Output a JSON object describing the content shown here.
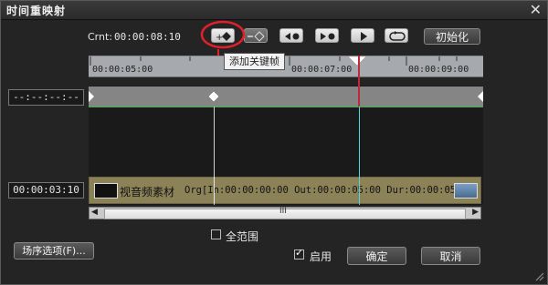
{
  "window": {
    "title": "时间重映射"
  },
  "toolbar": {
    "crnt_label": "Crnt:",
    "crnt_value": "00:00:08:10",
    "init_label": "初始化",
    "tooltip": "添加关键帧"
  },
  "ruler": {
    "ticks": [
      "00:00:05:00",
      "00:00:07:00",
      "00:00:09:00"
    ]
  },
  "fields": {
    "keyframe_time": "--:--:--:--",
    "clip_time": "00:00:03:10"
  },
  "clip": {
    "name": "视音频素材",
    "info": "Org[In:00:00:00:00 Out:00:00:05:00 Dur:00:00:05:0"
  },
  "scrollbar": {
    "thumb_glyph": "III"
  },
  "options": {
    "full_range_label": "全范围",
    "full_range_checked": false,
    "enable_label": "启用",
    "enable_checked": true
  },
  "buttons": {
    "sequence_options": "场序选项(F)...",
    "ok": "确定",
    "cancel": "取消"
  },
  "colors": {
    "playhead": "#c0283b",
    "cursor": "#4fd4e0",
    "kfline": "#3fb33f",
    "highlight_ring": "#e0202a"
  }
}
